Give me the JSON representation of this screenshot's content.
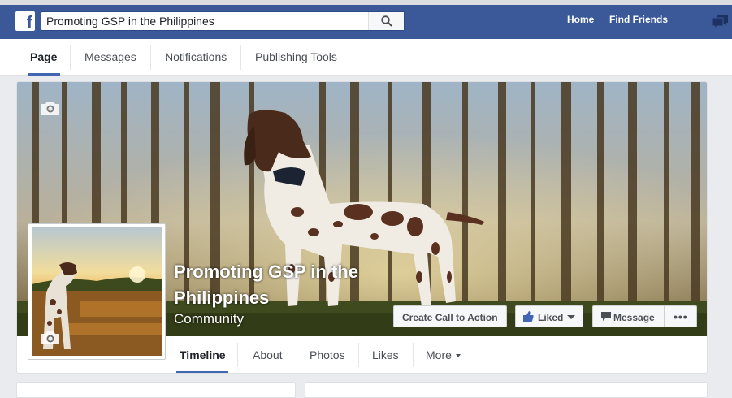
{
  "header": {
    "logo_letter": "f",
    "search": {
      "value": "Promoting GSP in the Philippines",
      "placeholder": ""
    },
    "nav": {
      "home": "Home",
      "find_friends": "Find Friends"
    },
    "colors": {
      "brand": "#3b5998",
      "accent": "#4267b2"
    }
  },
  "page_tabs": [
    "Page",
    "Messages",
    "Notifications",
    "Publishing Tools"
  ],
  "page": {
    "name": "Promoting GSP in the Philippines",
    "category": "Community"
  },
  "actions": {
    "cta": "Create Call to Action",
    "liked": "Liked",
    "message": "Message",
    "more": "•••"
  },
  "timeline_tabs": [
    "Timeline",
    "About",
    "Photos",
    "Likes",
    "More"
  ],
  "icons": [
    "facebook-logo-icon",
    "search-icon",
    "messages-jewel-icon",
    "camera-icon",
    "thumbs-up-icon",
    "chat-bubble-icon",
    "chevron-down-icon"
  ]
}
